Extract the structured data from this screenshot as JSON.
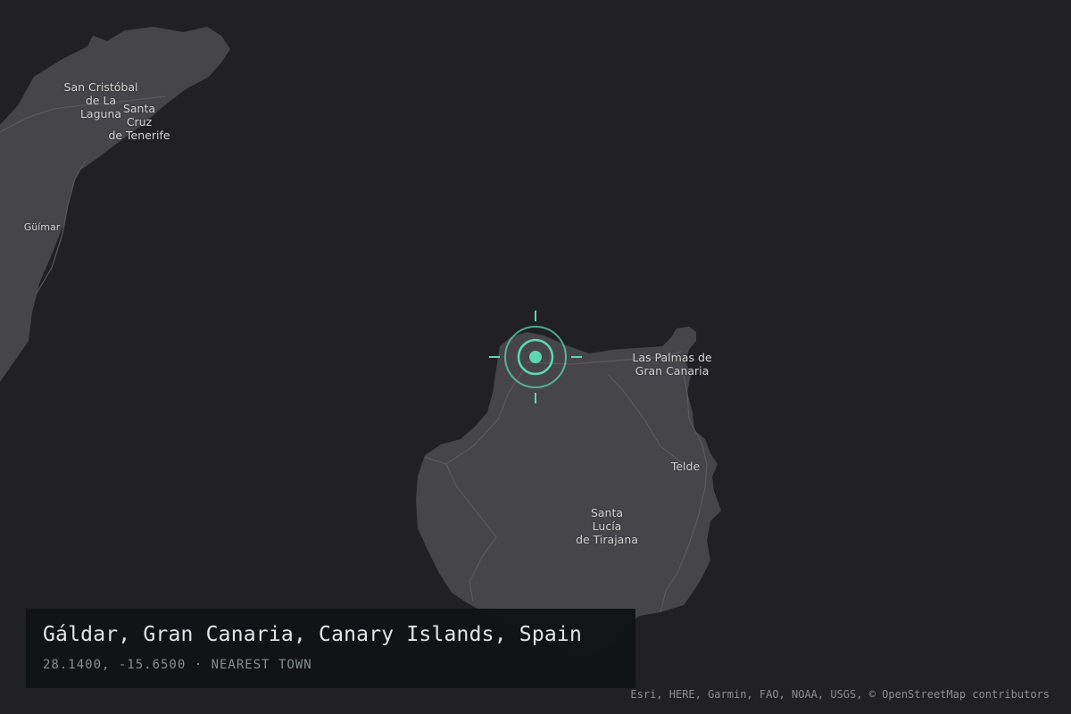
{
  "map": {
    "places": [
      {
        "id": "san-cristobal",
        "label": "San Cristóbal\nde La\nLaguna"
      },
      {
        "id": "santa-cruz",
        "label": "Santa\nCruz\nde Tenerife"
      },
      {
        "id": "guimar",
        "label": "Güímar"
      },
      {
        "id": "las-palmas",
        "label": "Las Palmas de\nGran Canaria"
      },
      {
        "id": "telde",
        "label": "Telde"
      },
      {
        "id": "santa-lucia",
        "label": "Santa\nLucía\nde Tirajana"
      }
    ],
    "marker": {
      "color": "#5fd6b2"
    },
    "colors": {
      "sea": "#212025",
      "land": "#46464a",
      "roads": "#5a5a5e"
    }
  },
  "info": {
    "title": "Gáldar, Gran Canaria, Canary Islands, Spain",
    "coordinates": "28.1400, -15.6500",
    "separator": "·",
    "subtitle": "28.1400, -15.6500 · NEAREST TOWN"
  },
  "attribution": "Esri, HERE, Garmin, FAO, NOAA, USGS, © OpenStreetMap contributors"
}
